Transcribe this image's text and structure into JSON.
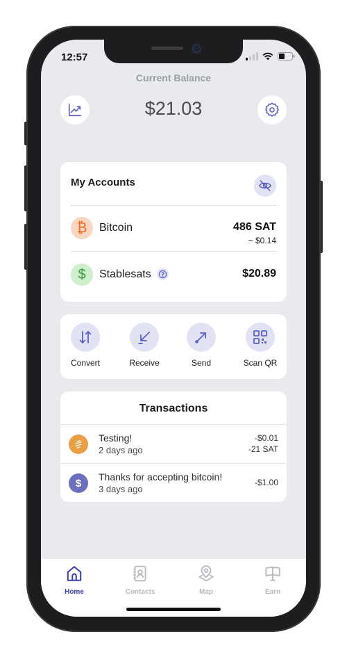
{
  "status_bar": {
    "time": "12:57"
  },
  "header": {
    "title": "Current Balance",
    "balance": "$21.03"
  },
  "icons": {
    "chart": "chart-line-icon",
    "settings": "gear-icon",
    "hide": "eye-off-icon",
    "help": "question-icon"
  },
  "accounts": {
    "title": "My Accounts",
    "items": [
      {
        "name": "Bitcoin",
        "value": "486 SAT",
        "sub_value": "~ $0.14",
        "icon": "bitcoin-icon",
        "icon_glyph": "₿",
        "color": "#f06a1f",
        "bg": "#f9d6c4"
      },
      {
        "name": "Stablesats",
        "value": "$20.89",
        "icon": "dollar-icon",
        "icon_glyph": "$",
        "color": "#3a9a3a",
        "bg": "#cfeecd"
      }
    ]
  },
  "actions": [
    {
      "label": "Convert",
      "icon": "convert-arrows-icon"
    },
    {
      "label": "Receive",
      "icon": "receive-arrow-icon"
    },
    {
      "label": "Send",
      "icon": "send-arrow-icon"
    },
    {
      "label": "Scan QR",
      "icon": "qr-code-icon"
    }
  ],
  "transactions": {
    "title": "Transactions",
    "items": [
      {
        "description": "Testing!",
        "date": "2 days ago",
        "amount_usd": "-$0.01",
        "amount_sat": "-21 SAT",
        "icon": "lightning-icon",
        "color": "#e9a045"
      },
      {
        "description": "Thanks for accepting bitcoin!",
        "date": "3 days ago",
        "amount_usd": "-$1.00",
        "icon": "dollar-icon",
        "icon_glyph": "$",
        "color": "#6a6fbf"
      }
    ]
  },
  "tabs": [
    {
      "label": "Home",
      "icon": "home-icon",
      "active": true
    },
    {
      "label": "Contacts",
      "icon": "contacts-icon",
      "active": false
    },
    {
      "label": "Map",
      "icon": "map-pin-icon",
      "active": false
    },
    {
      "label": "Earn",
      "icon": "earn-book-icon",
      "active": false
    }
  ],
  "colors": {
    "accent": "#3b3fb0",
    "icon_accent": "#5b5fc7",
    "tab_inactive": "#b8b9bf",
    "screen_bg": "#e9eaee"
  }
}
